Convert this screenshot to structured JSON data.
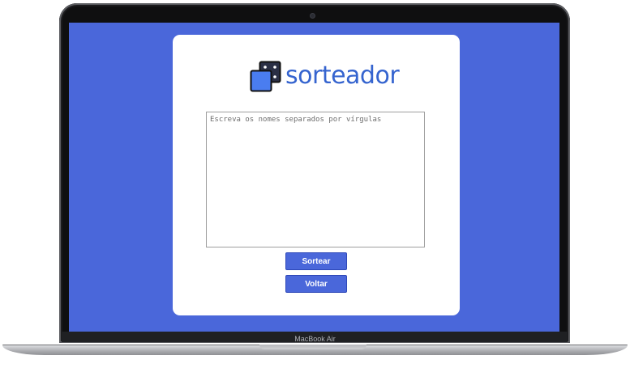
{
  "device": {
    "brand_label": "MacBook Air"
  },
  "app": {
    "logo_text": "sorteador",
    "logo_icon": "dice-icon",
    "names_input": {
      "value": "",
      "placeholder": "Escreva os nomes separados por vírgulas"
    },
    "buttons": {
      "draw_label": "Sortear",
      "back_label": "Voltar"
    }
  },
  "colors": {
    "background": "#4a67da",
    "card": "#ffffff",
    "logo_text": "#3564cf",
    "button": "#4a67da",
    "button_text": "#ffffff"
  }
}
